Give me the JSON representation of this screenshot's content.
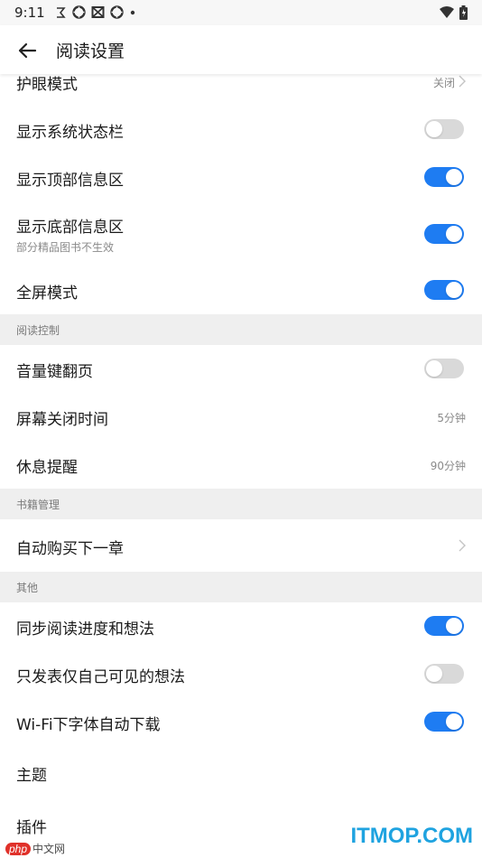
{
  "status_bar": {
    "time": "9:11"
  },
  "toolbar": {
    "title": "阅读设置"
  },
  "rows": [
    {
      "label": "护眼模式",
      "type": "chevron",
      "value": "关闭"
    },
    {
      "label": "显示系统状态栏",
      "type": "toggle",
      "on": false
    },
    {
      "label": "显示顶部信息区",
      "type": "toggle",
      "on": true
    },
    {
      "label": "显示底部信息区",
      "sub": "部分精品图书不生效",
      "type": "toggle",
      "on": true
    },
    {
      "label": "全屏模式",
      "type": "toggle",
      "on": true
    }
  ],
  "section_reading": {
    "label": "阅读控制"
  },
  "rows_reading": [
    {
      "label": "音量键翻页",
      "type": "toggle",
      "on": false
    },
    {
      "label": "屏幕关闭时间",
      "type": "value",
      "value": "5分钟"
    },
    {
      "label": "休息提醒",
      "type": "value",
      "value": "90分钟"
    }
  ],
  "section_books": {
    "label": "书籍管理"
  },
  "rows_books": [
    {
      "label": "自动购买下一章",
      "type": "chevron",
      "value": ""
    }
  ],
  "section_other": {
    "label": "其他"
  },
  "rows_other": [
    {
      "label": "同步阅读进度和想法",
      "type": "toggle",
      "on": true
    },
    {
      "label": "只发表仅自己可见的想法",
      "type": "toggle",
      "on": false
    },
    {
      "label": "Wi-Fi下字体自动下载",
      "type": "toggle",
      "on": true
    },
    {
      "label": "主题",
      "type": "plain"
    },
    {
      "label": "插件",
      "type": "plain"
    }
  ],
  "watermark": {
    "brand": "ITMOP.COM",
    "php": "php",
    "site": "中文网"
  },
  "colors": {
    "accent": "#1e7cf2",
    "section_bg": "#efefef",
    "toggle_off": "#d9d9d9"
  }
}
